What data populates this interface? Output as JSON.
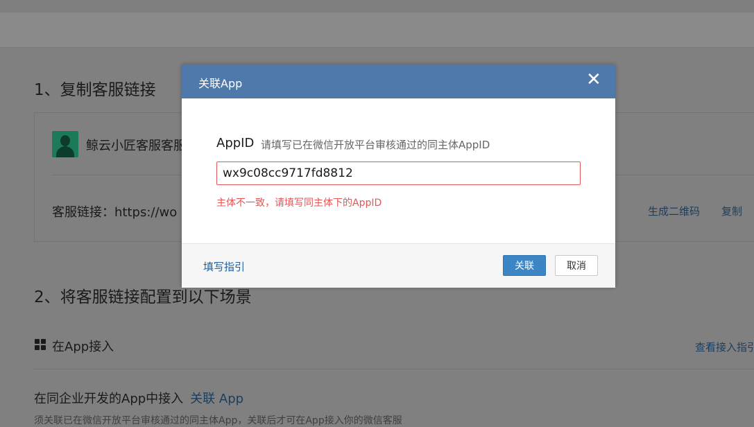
{
  "page": {
    "section1_title": "1、复制客服链接",
    "kf_name": "鲸云小匠客服客服",
    "link_label": "客服链接：https://wo",
    "qr_link": "生成二维码",
    "copy_link": "复制",
    "section2_title": "2、将客服链接配置到以下场景",
    "app_title": "在App接入",
    "guide_link": "查看接入指引",
    "assoc_text": "在同企业开发的App中接入",
    "assoc_link": "关联 App",
    "note": "须关联已在微信开放平台审核通过的同主体App，关联后才可在App接入你的微信客服"
  },
  "dialog": {
    "title": "关联App",
    "close_symbol": "✕",
    "field_label": "AppID",
    "field_hint": "请填写已在微信开放平台审核通过的同主体AppID",
    "field_value": "wx9c08cc9717fd8812",
    "error": "主体不一致，请填写同主体下的AppID",
    "guide": "填写指引",
    "ok": "关联",
    "cancel": "取消"
  },
  "colors": {
    "header": "#4f79ab",
    "primary_button": "#3d86c6",
    "error": "#e15656",
    "link": "#1d5fa0"
  },
  "icons": [
    "close-icon",
    "grid-icon",
    "avatar"
  ]
}
